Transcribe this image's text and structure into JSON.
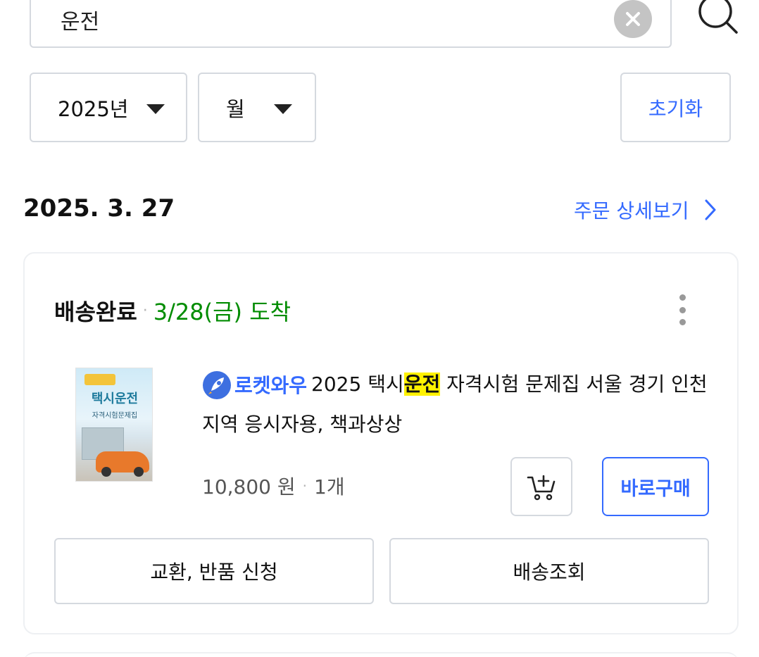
{
  "search": {
    "value": "운전"
  },
  "filters": {
    "year": "2025년",
    "month": "월",
    "reset_label": "초기화"
  },
  "order": {
    "date": "2025. 3. 27",
    "detail_link": "주문 상세보기",
    "status": "배송완료",
    "arrival": "3/28(금) 도착",
    "product": {
      "badge_label": "로켓와우",
      "name_before": "2025 택시",
      "name_highlight": "운전",
      "name_after": " 자격시험 문제집 서울 경기 인천 지역 응시자용, 책과상상",
      "thumbnail_title": "택시운전",
      "thumbnail_subtitle": "자격시험문제집",
      "price": "10,800 원",
      "quantity": "1개"
    },
    "buy_now_label": "바로구매",
    "actions": {
      "return_label": "교환, 반품 신청",
      "track_label": "배송조회"
    }
  },
  "colors": {
    "accent": "#346aff",
    "arrival": "#008c00",
    "highlight": "#fff200"
  },
  "icons": [
    "clear-icon",
    "search-icon",
    "caret-down-icon",
    "chevron-right-icon",
    "more-vertical-icon",
    "rocket-icon",
    "add-to-cart-icon"
  ]
}
